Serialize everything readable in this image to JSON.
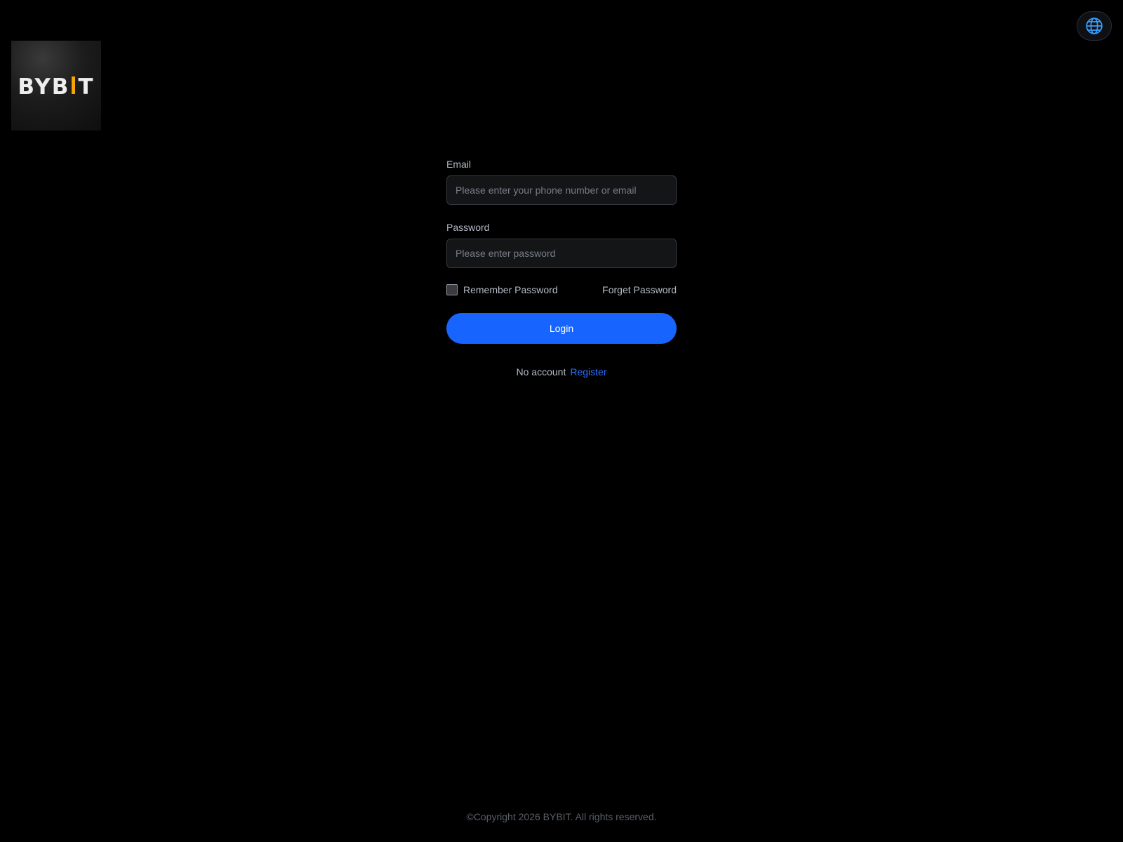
{
  "header": {
    "language_icon": "globe-icon"
  },
  "logo": {
    "prefix": "BYB",
    "suffix": "T",
    "accent_color": "#f7a600"
  },
  "form": {
    "email_label": "Email",
    "email_placeholder": "Please enter your phone number or email",
    "email_value": "",
    "password_label": "Password",
    "password_placeholder": "Please enter password",
    "password_value": "",
    "remember_label": "Remember Password",
    "remember_checked": false,
    "forget_label": "Forget Password",
    "login_label": "Login",
    "no_account_text": "No account",
    "register_label": "Register"
  },
  "colors": {
    "background": "#000000",
    "primary_button": "#1864ff",
    "link": "#2f6fff",
    "globe_icon": "#3aa0ff"
  },
  "footer": {
    "copyright": "©Copyright 2026 BYBIT. All rights reserved."
  }
}
